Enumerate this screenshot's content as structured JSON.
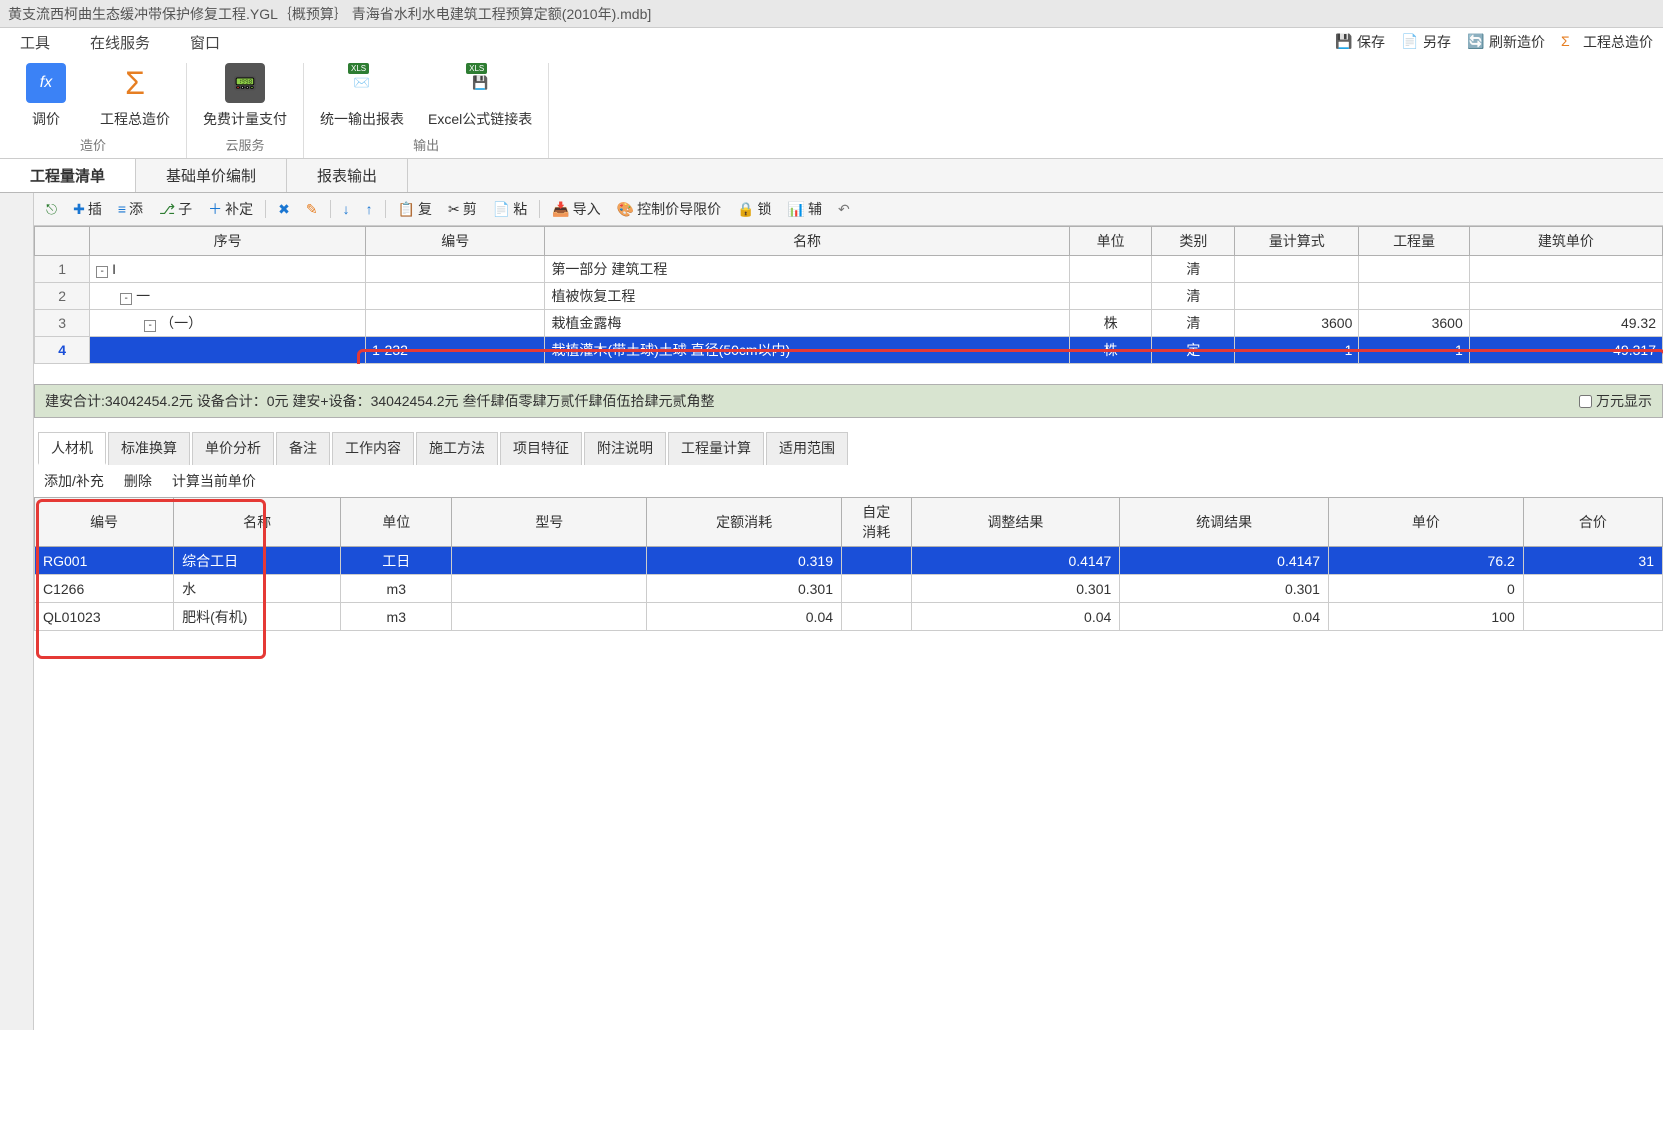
{
  "title_bar": "黄支流西柯曲生态缓冲带保护修复工程.YGL｛概预算｝ 青海省水利水电建筑工程预算定额(2010年).mdb]",
  "menu": {
    "tool": "工具",
    "online": "在线服务",
    "window": "窗口",
    "save": "保存",
    "save_as": "另存",
    "refresh_price": "刷新造价",
    "total_price": "工程总造价"
  },
  "ribbon": {
    "group1": {
      "btn_price": "价",
      "btn_adjust": "调价",
      "btn_total": "工程总造价",
      "name": "造价"
    },
    "group2": {
      "btn_free_calc": "免费计量支付",
      "name": "云服务"
    },
    "group3": {
      "btn_report": "统一输出报表",
      "btn_excel": "Excel公式链接表",
      "name": "输出"
    }
  },
  "viewtabs": {
    "tab1": "工程量清单",
    "tab2": "基础单价编制",
    "tab3": "报表输出"
  },
  "toolbar": {
    "tree": "",
    "insert": "插",
    "add": "添",
    "child": "子",
    "supp": "补定",
    "dup": "复",
    "cut": "剪",
    "paste": "粘",
    "import": "导入",
    "ctrl_price": "控制价导限价",
    "lock": "锁",
    "aux": "辅"
  },
  "upper_headers": [
    "",
    "序号",
    "编号",
    "名称",
    "单位",
    "类别",
    "量计算式",
    "工程量",
    "建筑单价"
  ],
  "upper_rows": [
    {
      "n": "1",
      "seq": "I",
      "code": "",
      "name": "第一部分 建筑工程",
      "unit": "",
      "cat": "清",
      "calc": "",
      "qty": "",
      "price": "",
      "tree": "minus",
      "indent": 0
    },
    {
      "n": "2",
      "seq": "一",
      "code": "",
      "name": "植被恢复工程",
      "unit": "",
      "cat": "清",
      "calc": "",
      "qty": "",
      "price": "",
      "tree": "minus",
      "indent": 1
    },
    {
      "n": "3",
      "seq": "（一）",
      "code": "",
      "name": "栽植金露梅",
      "unit": "株",
      "cat": "清",
      "calc": "3600",
      "qty": "3600",
      "price": "49.32",
      "tree": "minus",
      "indent": 2
    },
    {
      "n": "4",
      "seq": "",
      "code": "1-232",
      "name": "栽植灌木(带土球)土球 直径(50cm以内)",
      "unit": "株",
      "cat": "定",
      "calc": "1",
      "qty": "1",
      "price": "49.317",
      "tree": "",
      "indent": 3,
      "selected": true
    }
  ],
  "summary": {
    "text": "建安合计:34042454.2元  设备合计：0元  建安+设备：34042454.2元   叁仟肆佰零肆万贰仟肆佰伍拾肆元贰角整",
    "chk_label": "万元显示"
  },
  "btabs": [
    "人材机",
    "标准换算",
    "单价分析",
    "备注",
    "工作内容",
    "施工方法",
    "项目特征",
    "附注说明",
    "工程量计算",
    "适用范围"
  ],
  "btm_tb": {
    "add": "添加/补充",
    "del": "删除",
    "calc": "计算当前单价"
  },
  "btm_headers": [
    "编号",
    "名称",
    "单位",
    "型号",
    "定额消耗",
    "自定\n消耗",
    "调整结果",
    "统调结果",
    "单价",
    "合价"
  ],
  "btm_rows": [
    {
      "code": "RG001",
      "name": "综合工日",
      "unit": "工日",
      "model": "",
      "cons": "0.319",
      "cust": "",
      "adj": "0.4147",
      "tot": "0.4147",
      "price": "76.2",
      "sum": "31",
      "selected": true
    },
    {
      "code": "C1266",
      "name": "水",
      "unit": "m3",
      "model": "",
      "cons": "0.301",
      "cust": "",
      "adj": "0.301",
      "tot": "0.301",
      "price": "0",
      "sum": ""
    },
    {
      "code": "QL01023",
      "name": "肥料(有机)",
      "unit": "m3",
      "model": "",
      "cons": "0.04",
      "cust": "",
      "adj": "0.04",
      "tot": "0.04",
      "price": "100",
      "sum": ""
    }
  ]
}
